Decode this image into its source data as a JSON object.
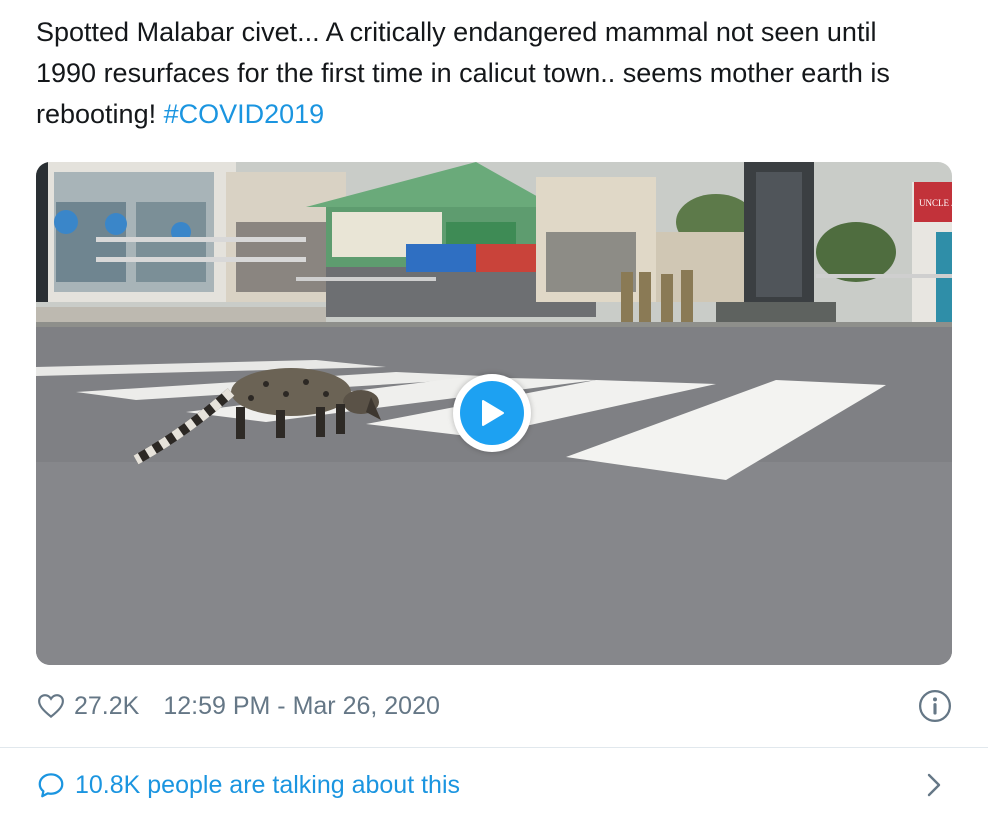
{
  "tweet": {
    "text": "Spotted Malabar civet... A critically endangered mammal not seen until 1990 resurfaces for the first time in calicut town.. seems mother earth is rebooting! ",
    "hashtag": "#COVID2019"
  },
  "media": {
    "type": "video",
    "play_icon": "play-icon",
    "sign_text": "UNCLE JOHN"
  },
  "meta": {
    "like_icon": "heart-icon",
    "like_count": "27.2K",
    "timestamp": "12:59 PM - Mar 26, 2020",
    "info_icon": "info-icon"
  },
  "conversation": {
    "icon": "speech-bubble-icon",
    "label": "10.8K people are talking about this",
    "chevron_icon": "chevron-right-icon"
  },
  "colors": {
    "link": "#1b95e0",
    "text": "#14171a",
    "secondary": "#657786",
    "play_accent": "#1da1f2",
    "divider": "#e1e8ed"
  }
}
